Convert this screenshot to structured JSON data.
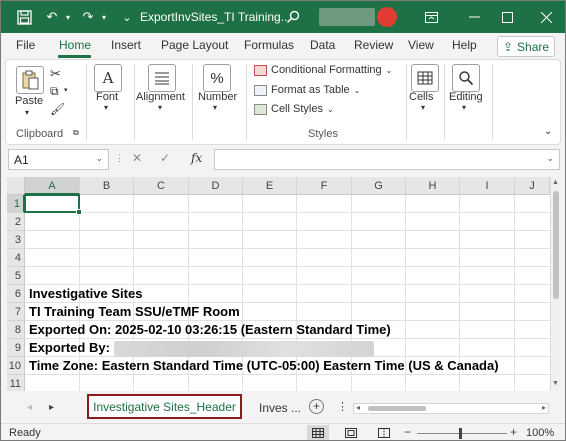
{
  "title_bar": {
    "filename": "ExportInvSites_TI Training...",
    "colors": {
      "brand": "#1e7145",
      "record": "#e03c31"
    }
  },
  "ribbon_tabs": [
    "File",
    "Home",
    "Insert",
    "Page Layout",
    "Formulas",
    "Data",
    "Review",
    "View",
    "Help"
  ],
  "share_label": "Share",
  "ribbon": {
    "paste": "Paste",
    "clipboard": "Clipboard",
    "font": "Font",
    "alignment": "Alignment",
    "number": "Number",
    "conditional_formatting": "Conditional Formatting",
    "format_as_table": "Format as Table",
    "cell_styles": "Cell Styles",
    "styles": "Styles",
    "cells": "Cells",
    "editing": "Editing"
  },
  "formula_bar": {
    "name_box": "A1",
    "fx": "fx",
    "formula": ""
  },
  "columns": [
    "A",
    "B",
    "C",
    "D",
    "E",
    "F",
    "G",
    "H",
    "I",
    "J"
  ],
  "rows": [
    "1",
    "2",
    "3",
    "4",
    "5",
    "6",
    "7",
    "8",
    "9",
    "10",
    "11"
  ],
  "cells": {
    "r6": "Investigative Sites",
    "r7": "TI Training Team SSU/eTMF Room",
    "r8": "Exported On: 2025-02-10 03:26:15 (Eastern Standard Time)",
    "r9": "Exported By:",
    "r10": "Time Zone: Eastern Standard Time (UTC-05:00) Eastern Time (US & Canada)"
  },
  "sheets": {
    "active": "Investigative Sites_Header",
    "other": "Inves ..."
  },
  "status": {
    "text": "Ready",
    "zoom": "100%"
  }
}
